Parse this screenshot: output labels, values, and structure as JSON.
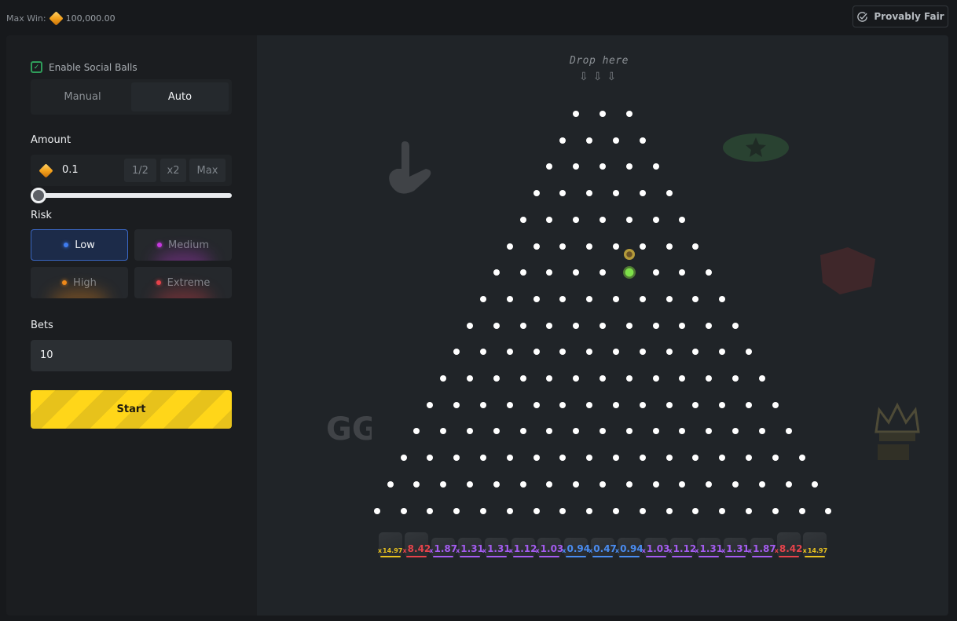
{
  "header": {
    "max_win_label": "Max Win:",
    "max_win_value": "100,000.00",
    "currency_icon": "gem-icon",
    "provably_fair_label": "Provably Fair",
    "provably_fair_icon": "check-circle-icon"
  },
  "sidebar": {
    "social_balls": {
      "label": "Enable Social Balls",
      "checked": true
    },
    "mode_tabs": [
      {
        "label": "Manual",
        "active": false
      },
      {
        "label": "Auto",
        "active": true
      }
    ],
    "amount": {
      "label": "Amount",
      "value": "0.1",
      "buttons": [
        "1/2",
        "x2",
        "Max"
      ],
      "slider_fraction": 0
    },
    "risk": {
      "label": "Risk",
      "options": [
        {
          "label": "Low",
          "color": "#3f7cf0",
          "selected": true
        },
        {
          "label": "Medium",
          "color": "#c73ae0",
          "selected": false
        },
        {
          "label": "High",
          "color": "#f08a1a",
          "selected": false
        },
        {
          "label": "Extreme",
          "color": "#e6434b",
          "selected": false
        }
      ]
    },
    "bets": {
      "label": "Bets",
      "value": "10"
    },
    "start_label": "Start"
  },
  "board": {
    "drop_hint": "Drop here",
    "rows": 16,
    "top_row_pegs": 3,
    "balls": [
      {
        "row": 5,
        "type": "social",
        "color": "#b49a3a"
      },
      {
        "row": 6,
        "type": "player",
        "color": "#7ee04a"
      }
    ],
    "multipliers": [
      {
        "value": "14.97",
        "color": "#e8c21f"
      },
      {
        "value": "8.42",
        "color": "#e6434b"
      },
      {
        "value": "1.87",
        "color": "#a45cf0"
      },
      {
        "value": "1.31",
        "color": "#a45cf0"
      },
      {
        "value": "1.31",
        "color": "#a45cf0"
      },
      {
        "value": "1.12",
        "color": "#a45cf0"
      },
      {
        "value": "1.03",
        "color": "#a45cf0"
      },
      {
        "value": "0.94",
        "color": "#4a8cf0"
      },
      {
        "value": "0.47",
        "color": "#4a8cf0"
      },
      {
        "value": "0.94",
        "color": "#4a8cf0"
      },
      {
        "value": "1.03",
        "color": "#a45cf0"
      },
      {
        "value": "1.12",
        "color": "#a45cf0"
      },
      {
        "value": "1.31",
        "color": "#a45cf0"
      },
      {
        "value": "1.31",
        "color": "#a45cf0"
      },
      {
        "value": "1.87",
        "color": "#a45cf0"
      },
      {
        "value": "8.42",
        "color": "#e6434b"
      },
      {
        "value": "14.97",
        "color": "#e8c21f"
      }
    ],
    "decorations": [
      "hand-sign-sticker",
      "cap-sticker",
      "graffiti-sticker",
      "gg-sticker",
      "crown-sticker"
    ]
  }
}
